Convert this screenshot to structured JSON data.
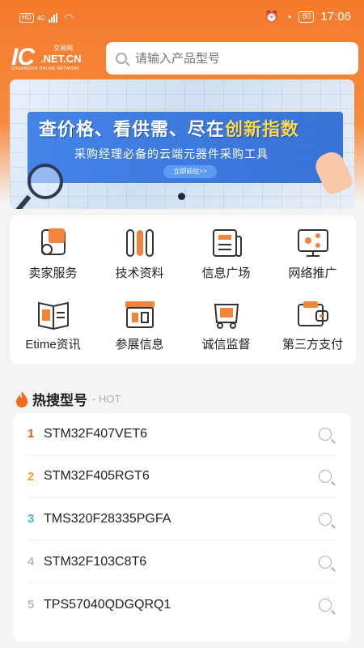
{
  "status_bar": {
    "network": "4G",
    "hd": "HD",
    "battery": "60",
    "time": "17:06"
  },
  "header": {
    "logo": {
      "ic": "IC",
      "net": ".NET.CN",
      "cn": "交易网",
      "tagline": "CHUANGXIN ONLINE NETWORK"
    },
    "search": {
      "placeholder": "请输入产品型号"
    }
  },
  "banner": {
    "headline_prefix": "查价格、看供需、尽在",
    "headline_highlight": "创新指数",
    "subline": "采购经理必备的云端元器件采购工具",
    "cta": "立即前往>>"
  },
  "menu": {
    "items": [
      {
        "label": "卖家服务",
        "icon": "seller-service-icon"
      },
      {
        "label": "技术资料",
        "icon": "tech-docs-icon"
      },
      {
        "label": "信息广场",
        "icon": "info-square-icon"
      },
      {
        "label": "网络推广",
        "icon": "network-promo-icon"
      },
      {
        "label": "Etime资讯",
        "icon": "etime-news-icon"
      },
      {
        "label": "参展信息",
        "icon": "exhibition-icon"
      },
      {
        "label": "诚信监督",
        "icon": "integrity-icon"
      },
      {
        "label": "第三方支付",
        "icon": "third-party-pay-icon"
      }
    ]
  },
  "hot": {
    "title": "热搜型号",
    "subtitle": "- HOT",
    "items": [
      {
        "rank": "1",
        "model": "STM32F407VET6",
        "color": "#e8542a"
      },
      {
        "rank": "2",
        "model": "STM32F405RGT6",
        "color": "#f0a21c"
      },
      {
        "rank": "3",
        "model": "TMS320F28335PGFA",
        "color": "#3cc1c8"
      },
      {
        "rank": "4",
        "model": "STM32F103C8T6",
        "color": "#bbbbbb"
      },
      {
        "rank": "5",
        "model": "TPS57040QDGQRQ1",
        "color": "#bbbbbb"
      }
    ]
  },
  "colors": {
    "brand_orange": "#f57a2c",
    "icon_orange": "#f2853c",
    "icon_dark": "#333333"
  }
}
